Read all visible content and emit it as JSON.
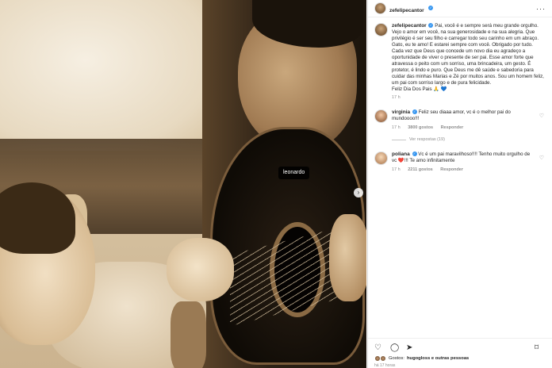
{
  "photo": {
    "tag": "leonardo"
  },
  "header": {
    "username": "zefelipecantor"
  },
  "caption": {
    "username": "zefelipecantor",
    "lines": [
      "Pai, você é e sempre será meu grande orgulho. Vejo o amor em você, na sua generosidade e na sua alegria. Que privilégio é ser seu filho e carregar todo seu carinho em um abraço. Gato, eu te amo! E estarei sempre com você. Obrigado por tudo.",
      "Cada vez que Deus que concede um novo dia eu agradeço a oportunidade de viver o presente de ser pai. Esse amor forte que atravessa o peito com um sorriso, uma brincadeira, um gesto. É protetor, é lindo e puro. Que Deus me dê saúde e sabedoria para cuidar das minhas Marias e Zé por muitos anos. Sou um homem feliz, um pai com sorriso largo e de pura felicidade.",
      "Feliz Dia Dos Pais 🙏 💙"
    ],
    "time": "17 h"
  },
  "comments": [
    {
      "username": "virginia",
      "text": "Feliz seu diaaa amor, vc é o melhor pai do mundoooo!!!",
      "time": "17 h",
      "likes": "3800 gostos",
      "reply": "Responder",
      "view_replies": "Ver respostas (19)"
    },
    {
      "username": "poliana",
      "text": "Vc é um pai maravilhoso!!!! Tenho muito orgulho de vc ❤️!!! Te amo infinitamente",
      "time": "17 h",
      "likes": "2211 gostos",
      "reply": "Responder"
    }
  ],
  "actions": {
    "liked_by_prefix": "Gostos:",
    "liked_by_names": "hugogloss e outras pessoas",
    "ago": "há 17 horas"
  },
  "icons": {
    "heart": "heart-icon",
    "comment": "comment-icon",
    "share": "share-icon",
    "save": "bookmark-icon",
    "more": "more-icon",
    "next": "chevron-right-icon"
  },
  "colors": {
    "verified": "#3897f0",
    "muted": "#8e8e8e",
    "text": "#262626"
  }
}
